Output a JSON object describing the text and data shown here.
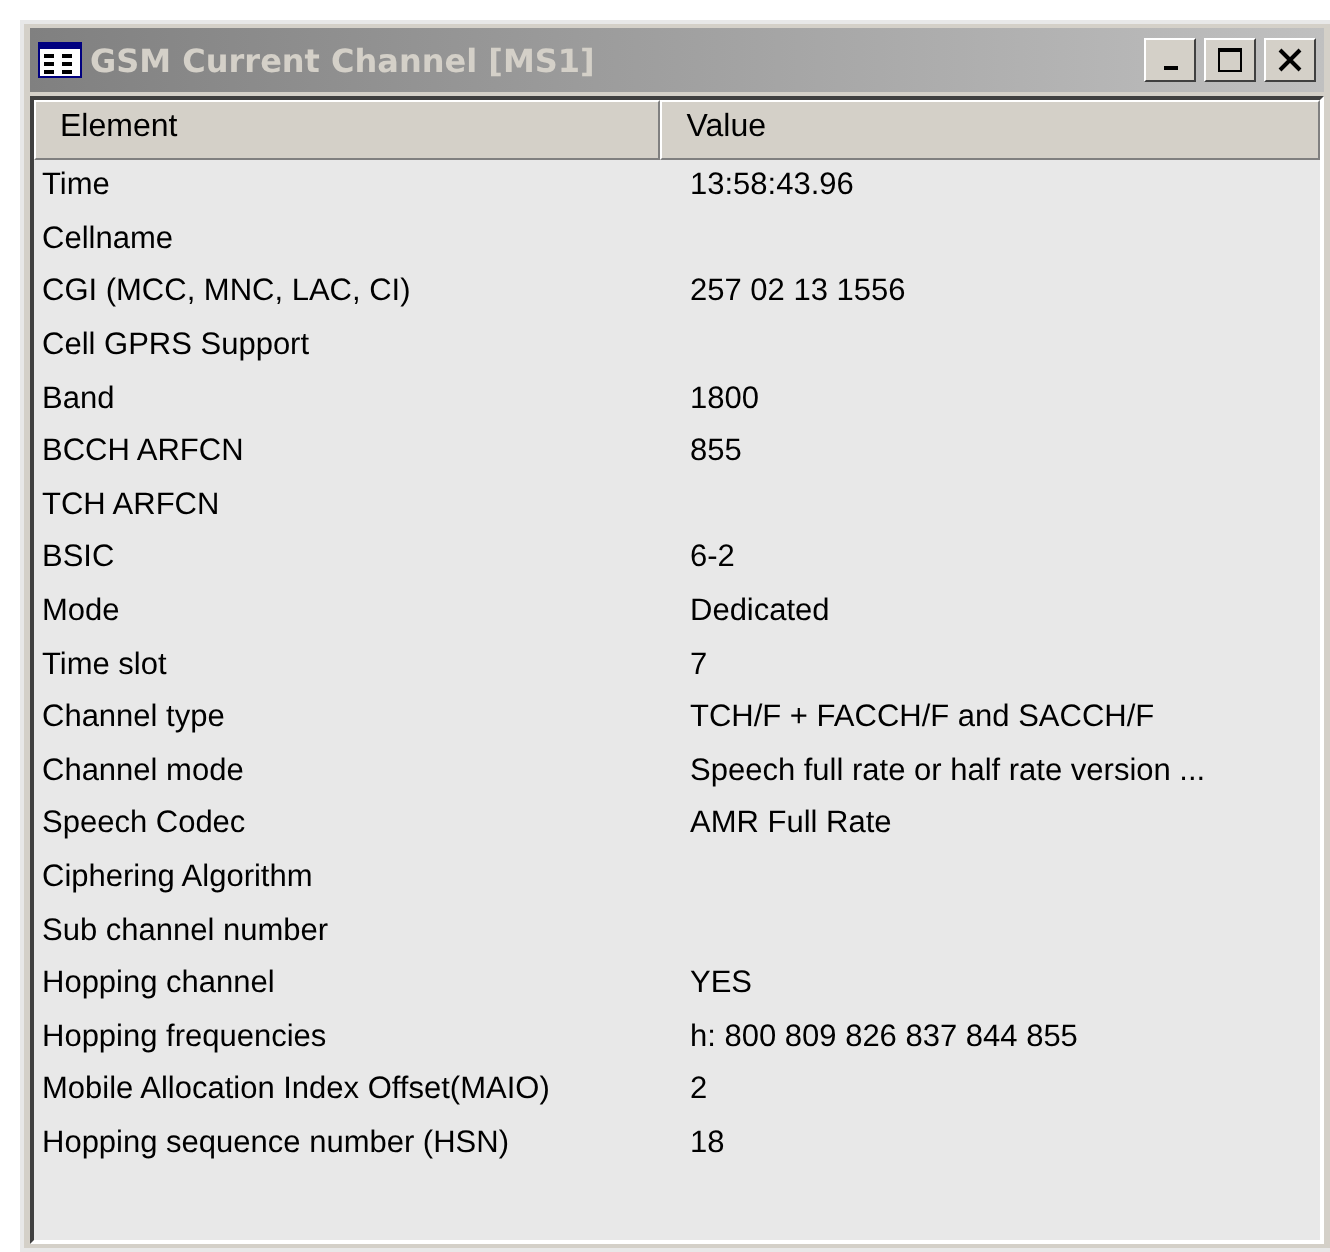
{
  "window": {
    "title": "GSM Current Channel [MS1]",
    "active": false
  },
  "table": {
    "columns": [
      "Element",
      "Value"
    ],
    "rows": [
      {
        "element": "Time",
        "value": "13:58:43.96"
      },
      {
        "element": "Cellname"
      },
      {
        "element": "CGI (MCC, MNC, LAC, CI)",
        "value": "257 02 13 1556"
      },
      {
        "element": "Cell GPRS Support"
      },
      {
        "element": "Band",
        "value": "1800"
      },
      {
        "element": "BCCH ARFCN",
        "value": "855"
      },
      {
        "element": "TCH ARFCN"
      },
      {
        "element": "BSIC",
        "value": "6-2"
      },
      {
        "element": "Mode",
        "value": "Dedicated"
      },
      {
        "element": "Time slot",
        "value": "7"
      },
      {
        "element": "Channel type",
        "value": "TCH/F + FACCH/F and SACCH/F"
      },
      {
        "element": "Channel mode",
        "value": "Speech full rate or half rate version ..."
      },
      {
        "element": "Speech Codec",
        "value": "AMR Full Rate"
      },
      {
        "element": "Ciphering Algorithm"
      },
      {
        "element": "Sub channel number"
      },
      {
        "element": "Hopping channel",
        "value": "YES"
      },
      {
        "element": "Hopping frequencies",
        "value": "h: 800 809 826 837 844 855"
      },
      {
        "element": "Mobile Allocation Index Offset(MAIO)",
        "value": "2"
      },
      {
        "element": "Hopping sequence number (HSN)",
        "value": "18"
      }
    ]
  }
}
